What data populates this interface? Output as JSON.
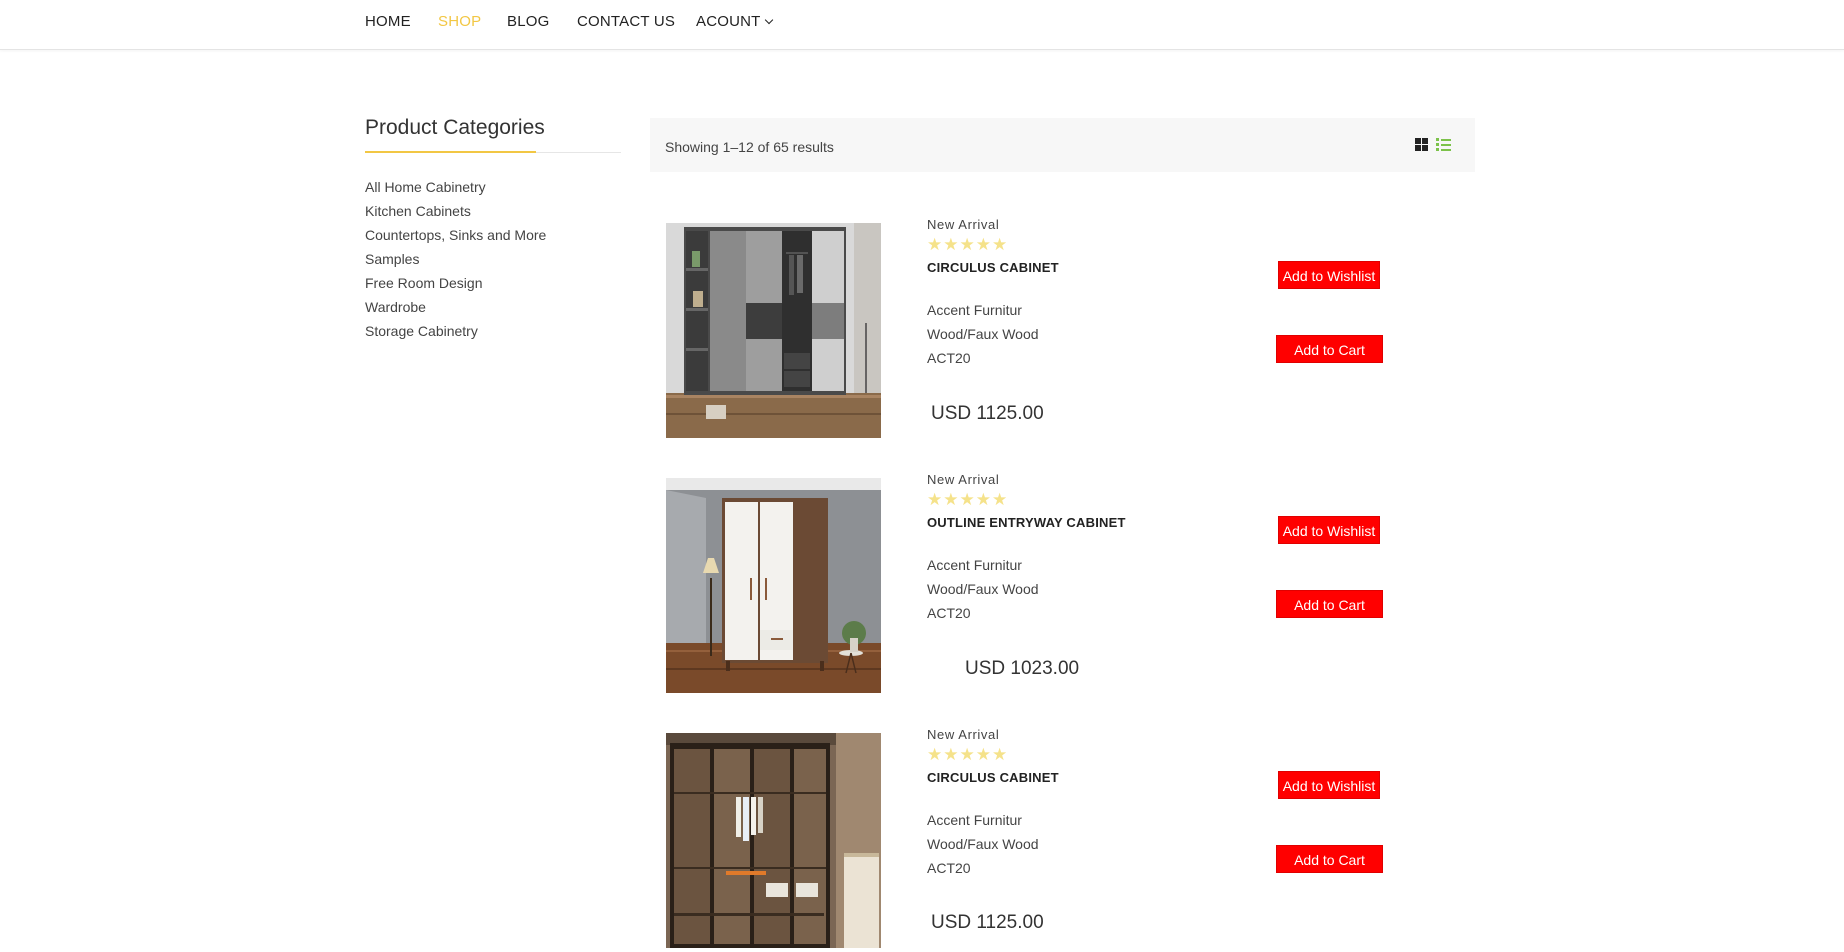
{
  "nav": {
    "items": [
      {
        "label": "HOME",
        "active": false
      },
      {
        "label": "SHOP",
        "active": true
      },
      {
        "label": "BLOG",
        "active": false
      },
      {
        "label": "CONTACT US",
        "active": false
      },
      {
        "label": "ACOUNT",
        "active": false,
        "dropdown": true
      }
    ],
    "active_color": "#f2c744"
  },
  "sidebar": {
    "title": "Product Categories",
    "accent_color": "#f2c744",
    "categories": [
      "All Home Cabinetry",
      "Kitchen Cabinets",
      "Countertops, Sinks and More",
      "Samples",
      "Free Room Design",
      "Wardrobe",
      "Storage Cabinetry"
    ]
  },
  "toolbar": {
    "result_count": "Showing 1–12 of 65 results",
    "grid_icon": "grid-view-icon",
    "list_icon": "list-view-icon",
    "list_icon_color": "#7cc24a"
  },
  "products": [
    {
      "badge": "New Arrival",
      "rating": 5,
      "name": "CIRCULUS CABINET",
      "specs": [
        "Accent Furnitur",
        "Wood/Faux Wood",
        "ACT20"
      ],
      "price": "USD 1125.00",
      "wishlist_label": "Add to Wishlist",
      "cart_label": "Add to Cart",
      "image": "grey-sliding-wardrobe"
    },
    {
      "badge": "New Arrival",
      "rating": 5,
      "name": "OUTLINE ENTRYWAY CABINET",
      "specs": [
        "Accent Furnitur",
        "Wood/Faux Wood",
        "ACT20"
      ],
      "price": "USD 1023.00",
      "wishlist_label": "Add to Wishlist",
      "cart_label": "Add to Cart",
      "image": "white-walnut-wardrobe"
    },
    {
      "badge": "New Arrival",
      "rating": 5,
      "name": "CIRCULUS CABINET",
      "specs": [
        "Accent Furnitur",
        "Wood/Faux Wood",
        "ACT20"
      ],
      "price": "USD 1125.00",
      "wishlist_label": "Add to Wishlist",
      "cart_label": "Add to Cart",
      "image": "glass-door-wardrobe"
    }
  ],
  "colors": {
    "button_red": "#ff0000",
    "star_yellow": "#f5e28a"
  }
}
